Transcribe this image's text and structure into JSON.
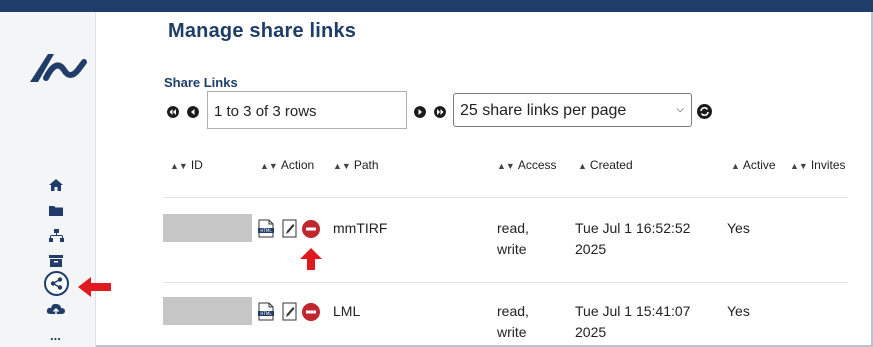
{
  "page": {
    "title": "Manage share links"
  },
  "table_section": {
    "label": "Share Links",
    "pagination": {
      "rows_text": "1 to 3 of 3 rows",
      "per_page": "25 share links per page"
    },
    "columns": [
      {
        "label": "ID",
        "sort": "both"
      },
      {
        "label": "Action",
        "sort": "both"
      },
      {
        "label": "Path",
        "sort": "both"
      },
      {
        "label": "Access",
        "sort": "both"
      },
      {
        "label": "Created",
        "sort": "asc"
      },
      {
        "label": "Active",
        "sort": "asc"
      },
      {
        "label": "Invites",
        "sort": "both"
      }
    ],
    "rows": [
      {
        "path": "mmTIRF",
        "access": [
          "read,",
          "write"
        ],
        "created": [
          "Tue Jul 1 16:52:52",
          "2025"
        ],
        "active": "Yes"
      },
      {
        "path": "LML",
        "access": [
          "read,",
          "write"
        ],
        "created": [
          "Tue Jul 1 15:41:07",
          "2025"
        ],
        "active": "Yes"
      }
    ]
  },
  "sidebar": {
    "icons": [
      "home-icon",
      "folder-icon",
      "network-icon",
      "archive-icon",
      "share-icon",
      "cloud-icon",
      "more-icon"
    ],
    "more_label": "...",
    "active": "share-icon"
  },
  "colors": {
    "brand": "#1f3d68",
    "annotation": "#e0191f",
    "delete": "#c0262d",
    "id_redaction": "#c6c6c6"
  }
}
